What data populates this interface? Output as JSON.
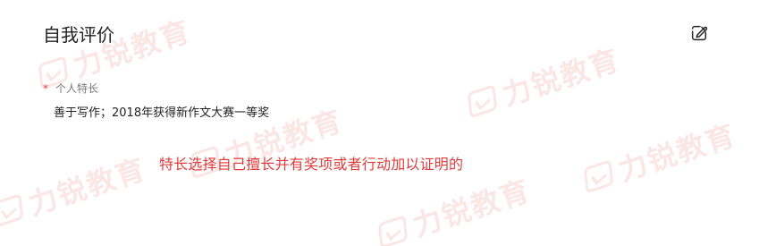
{
  "section": {
    "title": "自我评价"
  },
  "icons": {
    "edit": "edit-icon"
  },
  "field": {
    "required_mark": "*",
    "label": "个人特长",
    "value": "善于写作；2018年获得新作文大赛一等奖"
  },
  "annotation": {
    "text": "特长选择自己擅长并有奖项或者行动加以证明的"
  },
  "watermark": {
    "text": "力锐教育"
  },
  "colors": {
    "accent_red": "#e23b3b",
    "title_text": "#222222",
    "label_text": "#777777",
    "watermark": "#d9412f"
  }
}
